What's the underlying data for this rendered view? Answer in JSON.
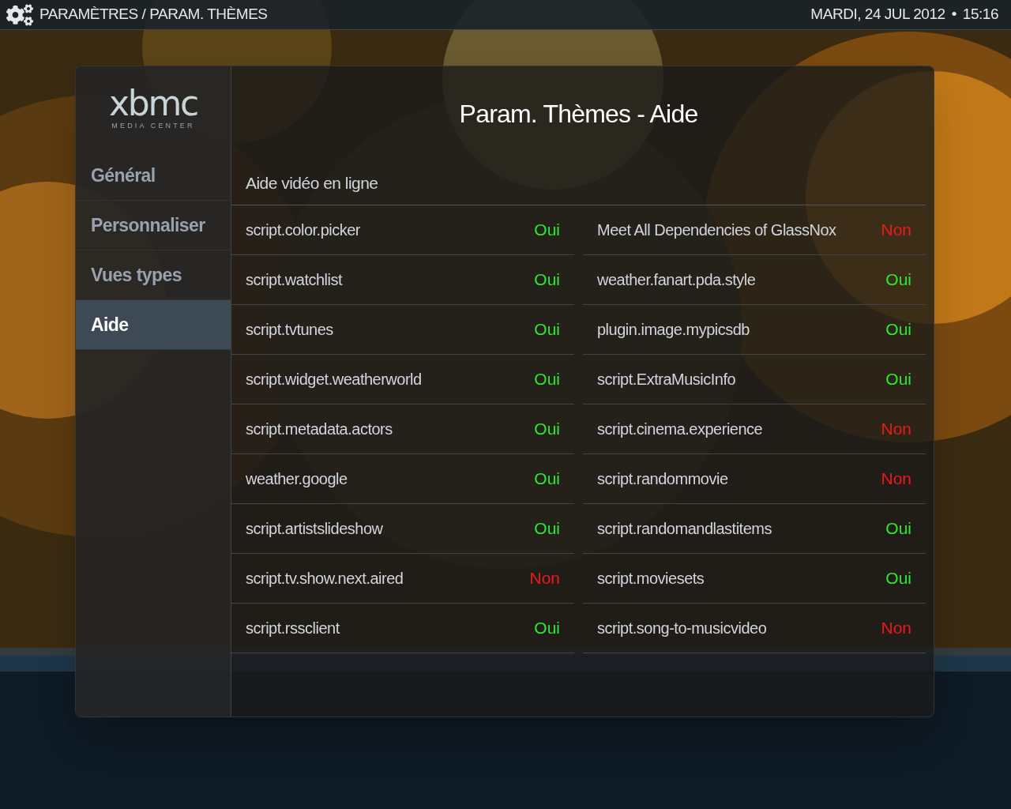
{
  "header": {
    "breadcrumb": "PARAMÈTRES / PARAM. THÈMES",
    "date": "MARDI, 24 JUL 2012",
    "separator": "•",
    "time": "15:16"
  },
  "logo": {
    "wordmark": "xbmc",
    "tagline": "MEDIA CENTER"
  },
  "sidebar": {
    "items": [
      {
        "label": "Général",
        "selected": false
      },
      {
        "label": "Personnaliser",
        "selected": false
      },
      {
        "label": "Vues types",
        "selected": false
      },
      {
        "label": "Aide",
        "selected": true
      }
    ]
  },
  "title": "Param. Thèmes - Aide",
  "section": "Aide vidéo en ligne",
  "addons": [
    {
      "name": "script.color.picker",
      "value": "Oui",
      "enabled": true
    },
    {
      "name": "Meet All Dependencies of GlassNox",
      "value": "Non",
      "enabled": false
    },
    {
      "name": "script.watchlist",
      "value": "Oui",
      "enabled": true
    },
    {
      "name": "weather.fanart.pda.style",
      "value": "Oui",
      "enabled": true
    },
    {
      "name": "script.tvtunes",
      "value": "Oui",
      "enabled": true
    },
    {
      "name": "plugin.image.mypicsdb",
      "value": "Oui",
      "enabled": true
    },
    {
      "name": "script.widget.weatherworld",
      "value": "Oui",
      "enabled": true
    },
    {
      "name": "script.ExtraMusicInfo",
      "value": "Oui",
      "enabled": true
    },
    {
      "name": "script.metadata.actors",
      "value": "Oui",
      "enabled": true
    },
    {
      "name": "script.cinema.experience",
      "value": "Non",
      "enabled": false
    },
    {
      "name": "weather.google",
      "value": "Oui",
      "enabled": true
    },
    {
      "name": "script.randommovie",
      "value": "Non",
      "enabled": false
    },
    {
      "name": "script.artistslideshow",
      "value": "Oui",
      "enabled": true
    },
    {
      "name": "script.randomandlastitems",
      "value": "Oui",
      "enabled": true
    },
    {
      "name": "script.tv.show.next.aired",
      "value": "Non",
      "enabled": false
    },
    {
      "name": "script.moviesets",
      "value": "Oui",
      "enabled": true
    },
    {
      "name": "script.rssclient",
      "value": "Oui",
      "enabled": true
    },
    {
      "name": "script.song-to-musicvideo",
      "value": "Non",
      "enabled": false
    }
  ]
}
